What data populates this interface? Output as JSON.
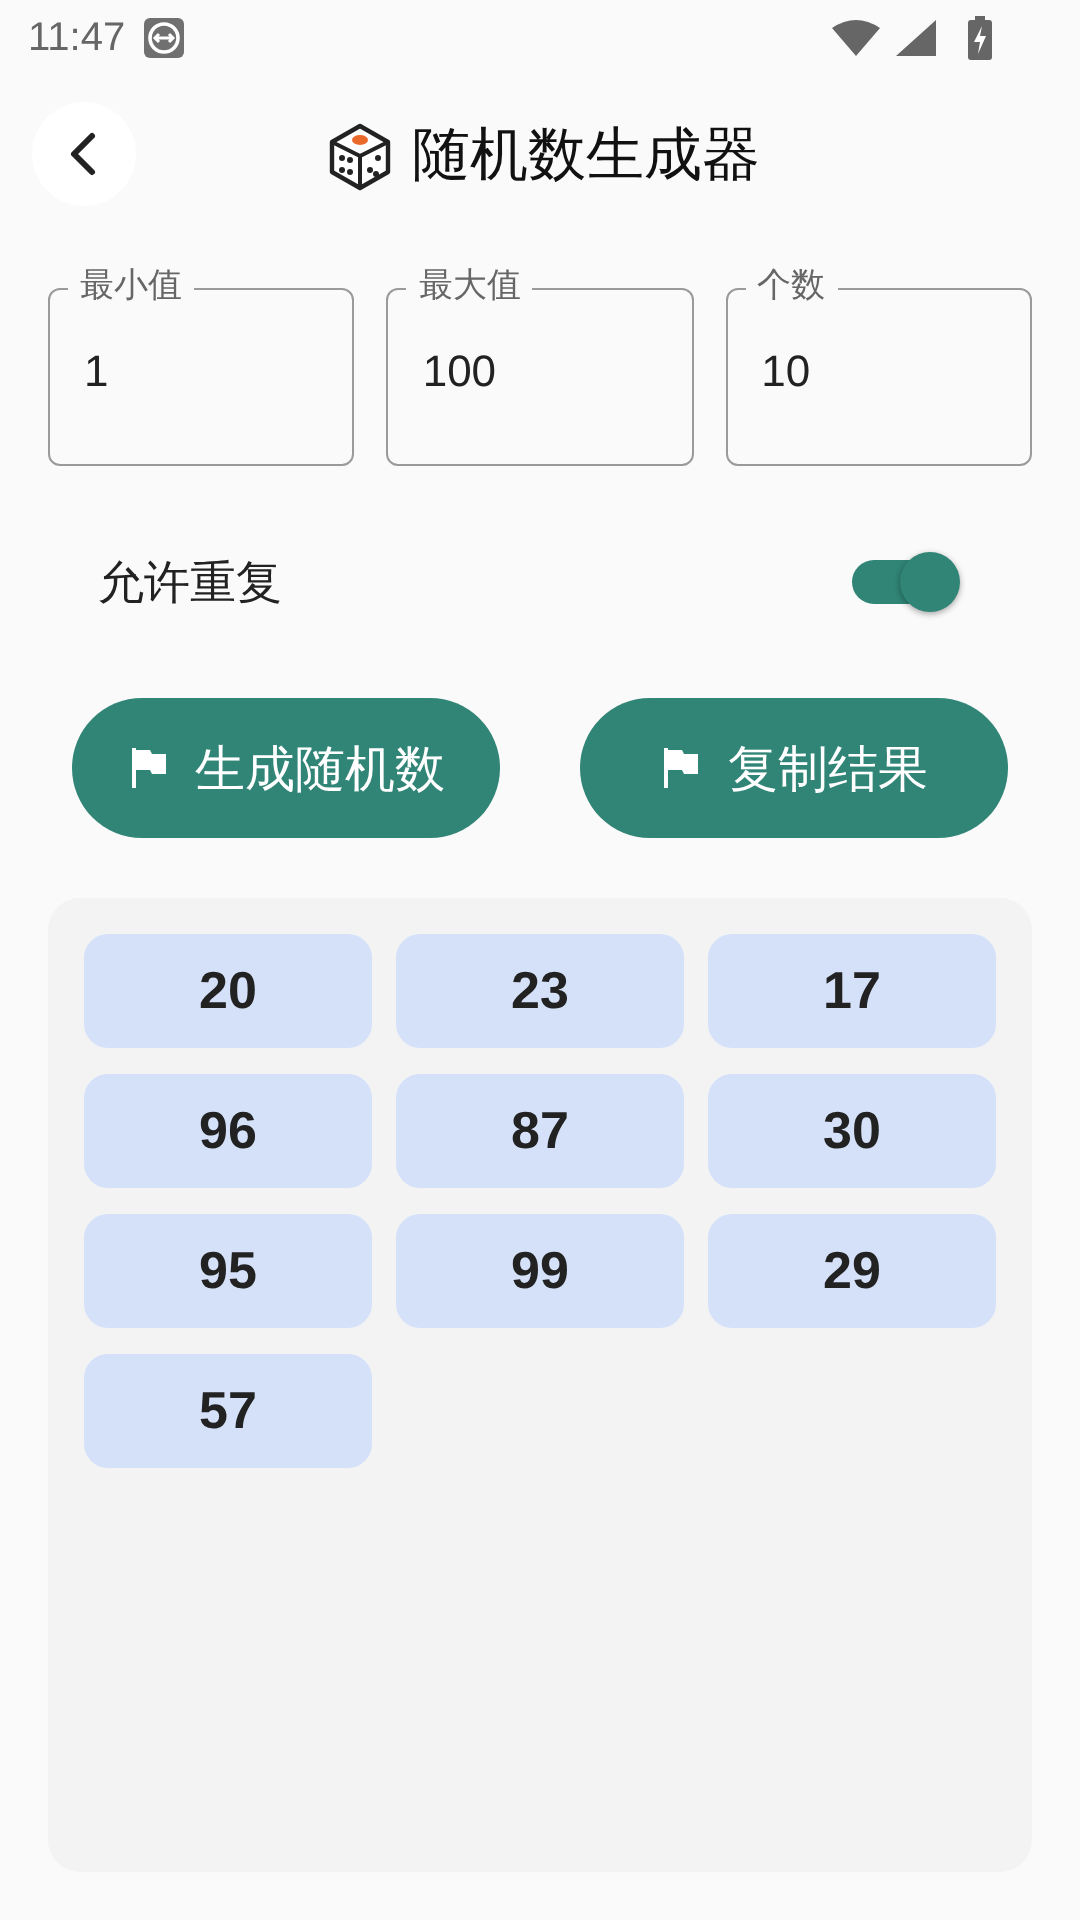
{
  "status_bar": {
    "time": "11:47"
  },
  "header": {
    "title": "随机数生成器"
  },
  "fields": [
    {
      "label": "最小值",
      "value": "1"
    },
    {
      "label": "最大值",
      "value": "100"
    },
    {
      "label": "个数",
      "value": "10"
    }
  ],
  "allow_repeat": {
    "label": "允许重复",
    "on": true
  },
  "buttons": [
    "生成随机数",
    "复制结果"
  ],
  "results": [
    "20",
    "23",
    "17",
    "96",
    "87",
    "30",
    "95",
    "99",
    "29",
    "57"
  ]
}
